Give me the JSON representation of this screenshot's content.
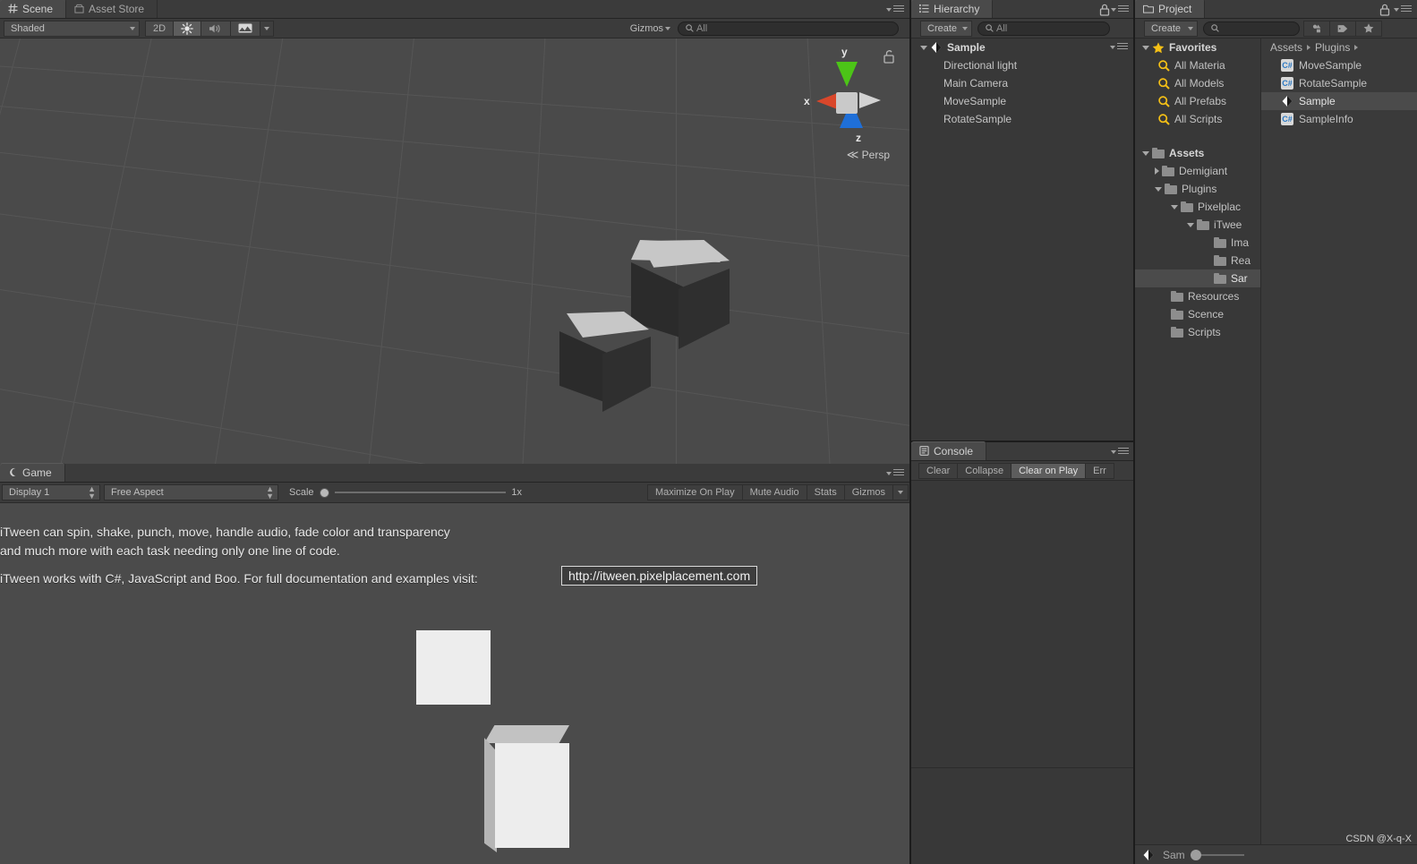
{
  "scene_view": {
    "tabs": [
      {
        "label": "Scene",
        "icon": "grid-hash-icon",
        "active": true
      },
      {
        "label": "Asset Store",
        "icon": "store-icon",
        "active": false
      }
    ],
    "toolbar": {
      "shading_mode": "Shaded",
      "mode_2d": "2D",
      "lighting_icon": "sun-icon",
      "audio_icon": "speaker-icon",
      "effects_icon": "image-effects-icon",
      "gizmos_label": "Gizmos",
      "search_placeholder": "All",
      "search_icon": "search-icon"
    },
    "gizmo": {
      "axis_x": "x",
      "axis_y": "y",
      "axis_z": "z",
      "projection": "Persp",
      "color_x": "#d9472b",
      "color_y": "#4cc417",
      "color_z": "#1f6fd8",
      "lock_icon": "lock-open-icon"
    },
    "background_color": "#4a4a4a",
    "grid_color": "#565656"
  },
  "game_view": {
    "tabs": [
      {
        "label": "Game",
        "icon": "gamepad-icon",
        "active": true
      }
    ],
    "toolbar": {
      "display": "Display 1",
      "aspect": "Free Aspect",
      "scale_label": "Scale",
      "scale_value": "1x",
      "maximize_on_play": "Maximize On Play",
      "mute_audio": "Mute Audio",
      "stats": "Stats",
      "gizmos": "Gizmos"
    },
    "content": {
      "line1": "iTween can spin, shake, punch, move, handle audio, fade color and transparency",
      "line2": "and much more with each task needing only one line of code.",
      "line3": "iTween works with C#, JavaScript and Boo. For full documentation and examples visit:",
      "url": "http://itween.pixelplacement.com"
    }
  },
  "hierarchy": {
    "tab_label": "Hierarchy",
    "tab_icon": "hierarchy-list-icon",
    "lock_icon": "lock-icon",
    "menu_icon": "panel-menu-icon",
    "create_label": "Create",
    "search_placeholder": "All",
    "scene_name": "Sample",
    "scene_icon": "unity-scene-icon",
    "objects": [
      {
        "label": "Directional light"
      },
      {
        "label": "Main Camera"
      },
      {
        "label": "MoveSample"
      },
      {
        "label": "RotateSample"
      }
    ]
  },
  "console": {
    "tab_label": "Console",
    "tab_icon": "console-icon",
    "menu_icon": "panel-menu-icon",
    "buttons": [
      {
        "label": "Clear",
        "active": false
      },
      {
        "label": "Collapse",
        "active": false
      },
      {
        "label": "Clear on Play",
        "active": true
      },
      {
        "label": "Err",
        "active": false
      }
    ]
  },
  "project": {
    "tab_label": "Project",
    "tab_icon": "folder-icon",
    "lock_icon": "lock-icon",
    "menu_icon": "panel-menu-icon",
    "create_label": "Create",
    "search_placeholder": "",
    "search_icon": "search-icon",
    "toolbar_icons": [
      {
        "name": "filter-by-type-icon"
      },
      {
        "name": "filter-by-label-icon"
      },
      {
        "name": "favorite-star-icon"
      }
    ],
    "tree": [
      {
        "label": "Favorites",
        "indent": 0,
        "twist": "down",
        "icon": "star-icon",
        "bold": true,
        "selected": false
      },
      {
        "label": "All Materia",
        "indent": 1,
        "twist": "none",
        "icon": "search-icon",
        "bold": false,
        "selected": false
      },
      {
        "label": "All Models",
        "indent": 1,
        "twist": "none",
        "icon": "search-icon",
        "bold": false,
        "selected": false
      },
      {
        "label": "All Prefabs",
        "indent": 1,
        "twist": "none",
        "icon": "search-icon",
        "bold": false,
        "selected": false
      },
      {
        "label": "All Scripts",
        "indent": 1,
        "twist": "none",
        "icon": "search-icon",
        "bold": false,
        "selected": false
      },
      {
        "label": "",
        "indent": 0,
        "twist": "none",
        "icon": "none",
        "bold": false,
        "selected": false
      },
      {
        "label": "Assets",
        "indent": 0,
        "twist": "down",
        "icon": "folder-icon",
        "bold": true,
        "selected": false
      },
      {
        "label": "Demigiant",
        "indent": 1,
        "twist": "right",
        "icon": "folder-icon",
        "bold": false,
        "selected": false
      },
      {
        "label": "Plugins",
        "indent": 1,
        "twist": "down",
        "icon": "folder-icon",
        "bold": false,
        "selected": false
      },
      {
        "label": "Pixelplac",
        "indent": 2,
        "twist": "down",
        "icon": "folder-icon",
        "bold": false,
        "selected": false
      },
      {
        "label": "iTwee",
        "indent": 3,
        "twist": "down",
        "icon": "folder-icon",
        "bold": false,
        "selected": false
      },
      {
        "label": "Ima",
        "indent": 4,
        "twist": "none",
        "icon": "folder-icon",
        "bold": false,
        "selected": false
      },
      {
        "label": "Rea",
        "indent": 4,
        "twist": "none",
        "icon": "folder-icon",
        "bold": false,
        "selected": false
      },
      {
        "label": "Sar",
        "indent": 4,
        "twist": "none",
        "icon": "folder-icon",
        "bold": false,
        "selected": true
      },
      {
        "label": "Resources",
        "indent": 1,
        "twist": "none",
        "icon": "folder-icon",
        "bold": false,
        "selected": false
      },
      {
        "label": "Scence",
        "indent": 1,
        "twist": "none",
        "icon": "folder-icon",
        "bold": false,
        "selected": false
      },
      {
        "label": "Scripts",
        "indent": 1,
        "twist": "none",
        "icon": "folder-icon",
        "bold": false,
        "selected": false
      }
    ],
    "breadcrumb": [
      "Assets",
      "Plugins"
    ],
    "assets": [
      {
        "label": "MoveSample",
        "icon": "csharp-script-icon",
        "selected": false
      },
      {
        "label": "RotateSample",
        "icon": "csharp-script-icon",
        "selected": false
      },
      {
        "label": "Sample",
        "icon": "unity-scene-icon",
        "selected": true
      },
      {
        "label": "SampleInfo",
        "icon": "csharp-script-icon",
        "selected": false
      }
    ],
    "status_item": "Sam"
  },
  "watermark": "CSDN @X-q-X"
}
